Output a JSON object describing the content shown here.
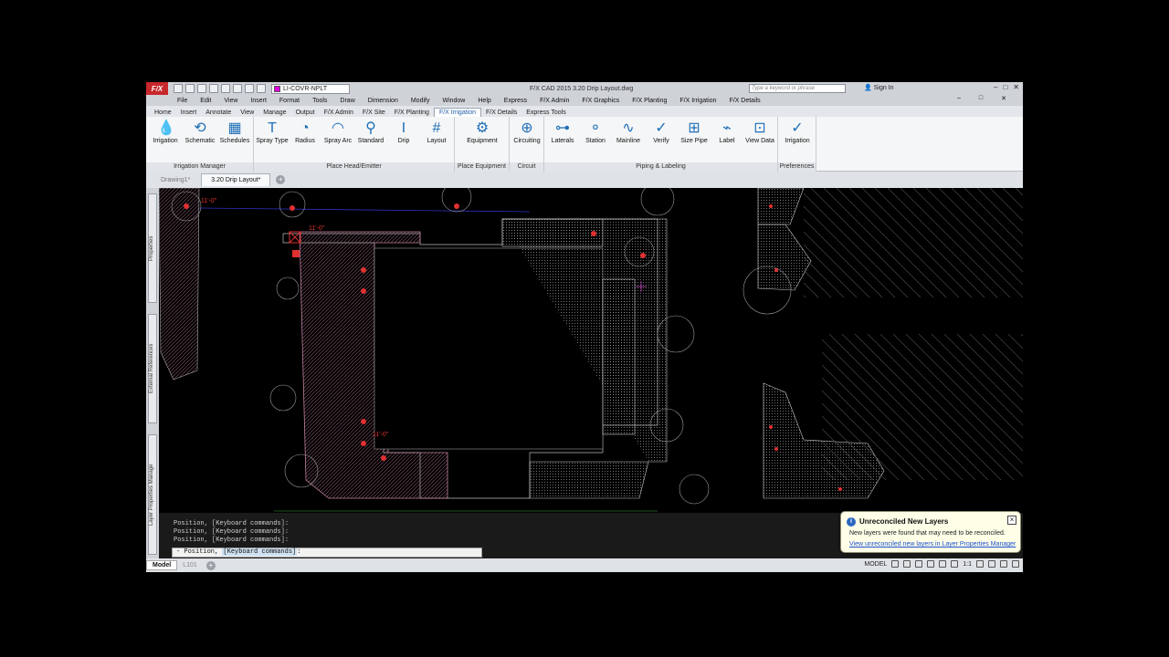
{
  "app": {
    "logo": "F/X",
    "window_title": "F/X CAD 2015    3.20 Drip Layout.dwg",
    "layer_current": "LI-COVR-NPLT",
    "search_placeholder": "Type a keyword or phrase",
    "sign_in": "Sign In",
    "win_min": "–",
    "win_max": "□",
    "win_close": "✕"
  },
  "menubar": [
    "File",
    "Edit",
    "View",
    "Insert",
    "Format",
    "Tools",
    "Draw",
    "Dimension",
    "Modify",
    "Window",
    "Help",
    "Express",
    "F/X Admin",
    "F/X Graphics",
    "F/X Planting",
    "F/X Irrigation",
    "F/X Details"
  ],
  "ribbon_tabs": [
    "Home",
    "Insert",
    "Annotate",
    "View",
    "Manage",
    "Output",
    "F/X Admin",
    "F/X Site",
    "F/X Planting",
    "F/X Irrigation",
    "F/X Details",
    "Express Tools"
  ],
  "ribbon_active": "F/X Irrigation",
  "ribbon_groups": [
    {
      "name": "Irrigation Manager",
      "buttons": [
        "Irrigation",
        "Schematic",
        "Schedules"
      ]
    },
    {
      "name": "Place Head/Emitter",
      "buttons": [
        "Spray Type",
        "Radius",
        "Spray Arc",
        "Standard",
        "Drip",
        "Layout"
      ]
    },
    {
      "name": "Place Equipment",
      "buttons": [
        "Equipment"
      ]
    },
    {
      "name": "Circuit",
      "buttons": [
        "Circuiting"
      ]
    },
    {
      "name": "Piping & Labeling",
      "buttons": [
        "Laterals",
        "Station",
        "Mainline",
        "Verify",
        "Size Pipe",
        "Label",
        "View Data"
      ]
    },
    {
      "name": "Preferences",
      "buttons": [
        "Irrigation"
      ]
    }
  ],
  "doc_tabs": [
    "Drawing1*",
    "3.20 Drip Layout*"
  ],
  "palette_tabs": [
    "Properties",
    "External References",
    "Layer Properties Manage"
  ],
  "drawing": {
    "dim1": "11'-0\"",
    "dim2": "11'-0\"",
    "dim3": "11'-0\""
  },
  "command": {
    "history": [
      "Position, [Keyboard commands]:",
      "Position, [Keyboard commands]:",
      "Position, [Keyboard commands]:"
    ],
    "prompt_prefix": "- Position, ",
    "prompt_kb": "[Keyboard commands]",
    "prompt_suffix": ":"
  },
  "status": {
    "tabs": [
      "Model",
      "L101"
    ],
    "model_label": "MODEL",
    "scale": "1:1"
  },
  "notification": {
    "title": "Unreconciled New Layers",
    "message": "New layers were found that may need to be reconciled.",
    "link": "View unreconciled new layers in Layer Properties Manager"
  },
  "colors": {
    "accent": "#1f5fa8",
    "logo": "#c8272b",
    "canvas": "#000000",
    "emitter": "#e03030"
  }
}
